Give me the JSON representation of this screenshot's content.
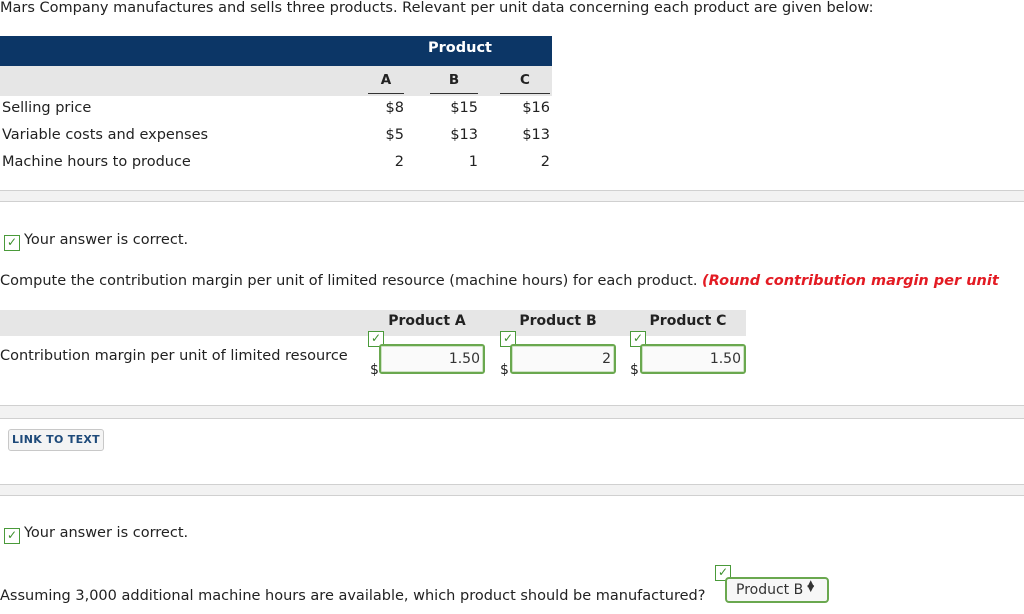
{
  "intro": "Mars Company manufactures and sells three products. Relevant per unit data concerning each product are given below:",
  "product_table": {
    "group_header": "Product",
    "columns": [
      "A",
      "B",
      "C"
    ],
    "rows": [
      {
        "label": "Selling price",
        "values": [
          "$8",
          "$15",
          "$16"
        ]
      },
      {
        "label": "Variable costs and expenses",
        "values": [
          "$5",
          "$13",
          "$13"
        ]
      },
      {
        "label": "Machine hours to produce",
        "values": [
          "2",
          "1",
          "2"
        ]
      }
    ]
  },
  "feedback": {
    "correct_1": "Your answer is correct.",
    "correct_2": "Your answer is correct."
  },
  "question_1": {
    "text": "Compute the contribution margin per unit of limited resource (machine hours) for each product.",
    "instruction": "(Round contribution margin per unit"
  },
  "cm_table": {
    "headers": [
      "Product A",
      "Product B",
      "Product C"
    ],
    "row_label": "Contribution margin per unit of limited resource",
    "currency": "$",
    "answers": [
      "1.50",
      "2",
      "1.50"
    ]
  },
  "link_to_text": "LINK TO TEXT",
  "question_2": {
    "text": "Assuming 3,000 additional machine hours are available, which product should be manufactured?",
    "selected": "Product B"
  },
  "colors": {
    "header_bg": "#0c3666",
    "correct_green": "#4a9a3a",
    "instruction_red": "#e31b23",
    "link_blue": "#1e4a7a"
  }
}
